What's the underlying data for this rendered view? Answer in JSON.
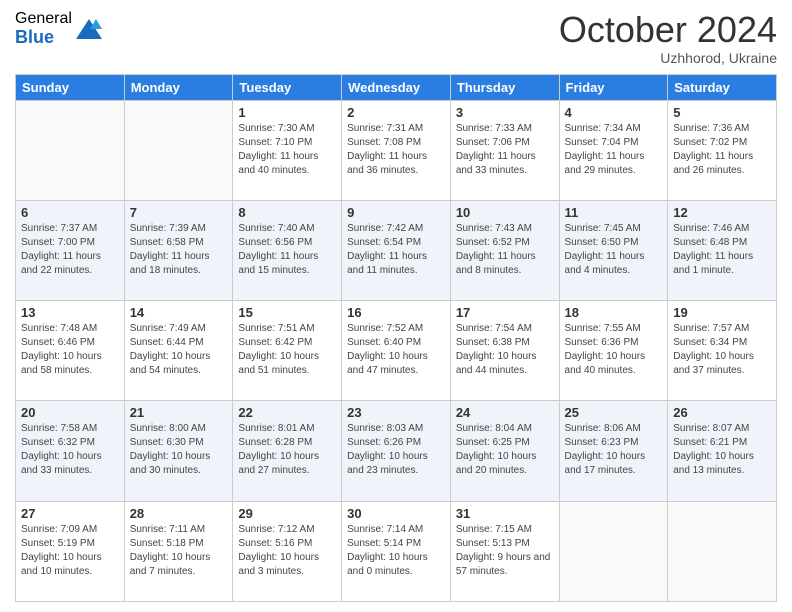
{
  "logo": {
    "general": "General",
    "blue": "Blue"
  },
  "header": {
    "month": "October 2024",
    "location": "Uzhhorod, Ukraine"
  },
  "days_of_week": [
    "Sunday",
    "Monday",
    "Tuesday",
    "Wednesday",
    "Thursday",
    "Friday",
    "Saturday"
  ],
  "weeks": [
    [
      {
        "day": "",
        "info": ""
      },
      {
        "day": "",
        "info": ""
      },
      {
        "day": "1",
        "info": "Sunrise: 7:30 AM\nSunset: 7:10 PM\nDaylight: 11 hours and 40 minutes."
      },
      {
        "day": "2",
        "info": "Sunrise: 7:31 AM\nSunset: 7:08 PM\nDaylight: 11 hours and 36 minutes."
      },
      {
        "day": "3",
        "info": "Sunrise: 7:33 AM\nSunset: 7:06 PM\nDaylight: 11 hours and 33 minutes."
      },
      {
        "day": "4",
        "info": "Sunrise: 7:34 AM\nSunset: 7:04 PM\nDaylight: 11 hours and 29 minutes."
      },
      {
        "day": "5",
        "info": "Sunrise: 7:36 AM\nSunset: 7:02 PM\nDaylight: 11 hours and 26 minutes."
      }
    ],
    [
      {
        "day": "6",
        "info": "Sunrise: 7:37 AM\nSunset: 7:00 PM\nDaylight: 11 hours and 22 minutes."
      },
      {
        "day": "7",
        "info": "Sunrise: 7:39 AM\nSunset: 6:58 PM\nDaylight: 11 hours and 18 minutes."
      },
      {
        "day": "8",
        "info": "Sunrise: 7:40 AM\nSunset: 6:56 PM\nDaylight: 11 hours and 15 minutes."
      },
      {
        "day": "9",
        "info": "Sunrise: 7:42 AM\nSunset: 6:54 PM\nDaylight: 11 hours and 11 minutes."
      },
      {
        "day": "10",
        "info": "Sunrise: 7:43 AM\nSunset: 6:52 PM\nDaylight: 11 hours and 8 minutes."
      },
      {
        "day": "11",
        "info": "Sunrise: 7:45 AM\nSunset: 6:50 PM\nDaylight: 11 hours and 4 minutes."
      },
      {
        "day": "12",
        "info": "Sunrise: 7:46 AM\nSunset: 6:48 PM\nDaylight: 11 hours and 1 minute."
      }
    ],
    [
      {
        "day": "13",
        "info": "Sunrise: 7:48 AM\nSunset: 6:46 PM\nDaylight: 10 hours and 58 minutes."
      },
      {
        "day": "14",
        "info": "Sunrise: 7:49 AM\nSunset: 6:44 PM\nDaylight: 10 hours and 54 minutes."
      },
      {
        "day": "15",
        "info": "Sunrise: 7:51 AM\nSunset: 6:42 PM\nDaylight: 10 hours and 51 minutes."
      },
      {
        "day": "16",
        "info": "Sunrise: 7:52 AM\nSunset: 6:40 PM\nDaylight: 10 hours and 47 minutes."
      },
      {
        "day": "17",
        "info": "Sunrise: 7:54 AM\nSunset: 6:38 PM\nDaylight: 10 hours and 44 minutes."
      },
      {
        "day": "18",
        "info": "Sunrise: 7:55 AM\nSunset: 6:36 PM\nDaylight: 10 hours and 40 minutes."
      },
      {
        "day": "19",
        "info": "Sunrise: 7:57 AM\nSunset: 6:34 PM\nDaylight: 10 hours and 37 minutes."
      }
    ],
    [
      {
        "day": "20",
        "info": "Sunrise: 7:58 AM\nSunset: 6:32 PM\nDaylight: 10 hours and 33 minutes."
      },
      {
        "day": "21",
        "info": "Sunrise: 8:00 AM\nSunset: 6:30 PM\nDaylight: 10 hours and 30 minutes."
      },
      {
        "day": "22",
        "info": "Sunrise: 8:01 AM\nSunset: 6:28 PM\nDaylight: 10 hours and 27 minutes."
      },
      {
        "day": "23",
        "info": "Sunrise: 8:03 AM\nSunset: 6:26 PM\nDaylight: 10 hours and 23 minutes."
      },
      {
        "day": "24",
        "info": "Sunrise: 8:04 AM\nSunset: 6:25 PM\nDaylight: 10 hours and 20 minutes."
      },
      {
        "day": "25",
        "info": "Sunrise: 8:06 AM\nSunset: 6:23 PM\nDaylight: 10 hours and 17 minutes."
      },
      {
        "day": "26",
        "info": "Sunrise: 8:07 AM\nSunset: 6:21 PM\nDaylight: 10 hours and 13 minutes."
      }
    ],
    [
      {
        "day": "27",
        "info": "Sunrise: 7:09 AM\nSunset: 5:19 PM\nDaylight: 10 hours and 10 minutes."
      },
      {
        "day": "28",
        "info": "Sunrise: 7:11 AM\nSunset: 5:18 PM\nDaylight: 10 hours and 7 minutes."
      },
      {
        "day": "29",
        "info": "Sunrise: 7:12 AM\nSunset: 5:16 PM\nDaylight: 10 hours and 3 minutes."
      },
      {
        "day": "30",
        "info": "Sunrise: 7:14 AM\nSunset: 5:14 PM\nDaylight: 10 hours and 0 minutes."
      },
      {
        "day": "31",
        "info": "Sunrise: 7:15 AM\nSunset: 5:13 PM\nDaylight: 9 hours and 57 minutes."
      },
      {
        "day": "",
        "info": ""
      },
      {
        "day": "",
        "info": ""
      }
    ]
  ]
}
